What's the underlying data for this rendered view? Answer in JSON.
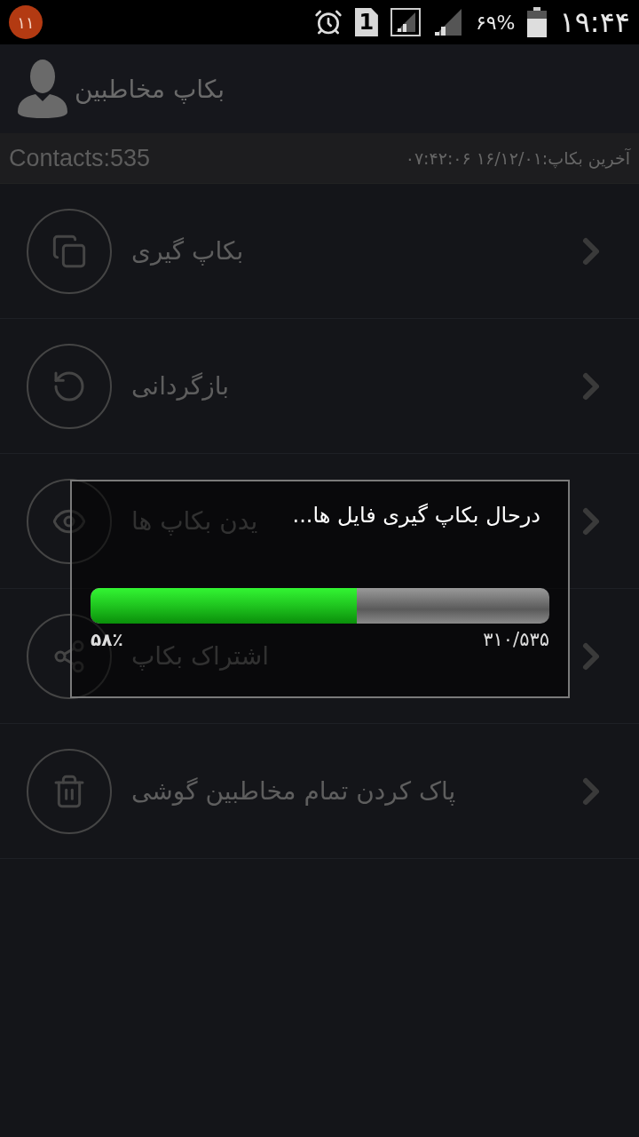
{
  "status_bar": {
    "notification_count": "۱۱",
    "sim_label": "1",
    "battery": "۶۹%",
    "time": "۱۹:۴۴"
  },
  "header": {
    "title": "بکاپ مخاطبین"
  },
  "info_bar": {
    "contacts": "Contacts:535",
    "last_backup": "آخرین بکاپ:۱۶/۱۲/۰۱ ۰۷:۴۲:۰۶"
  },
  "menu": [
    {
      "kind": "backup",
      "label": "بکاپ گیری"
    },
    {
      "kind": "restore",
      "label": "بازگردانی"
    },
    {
      "kind": "view",
      "label": "یدن بکاپ ها"
    },
    {
      "kind": "share",
      "label": "اشتراک بکاپ"
    },
    {
      "kind": "delete",
      "label": "پاک کردن تمام مخاطبین گوشی"
    }
  ],
  "dialog": {
    "title": "درحال بکاپ گیری فایل ها...",
    "level": 0.58,
    "percent": "۵۸٪",
    "count": "۳۱۰/۵۳۵"
  }
}
